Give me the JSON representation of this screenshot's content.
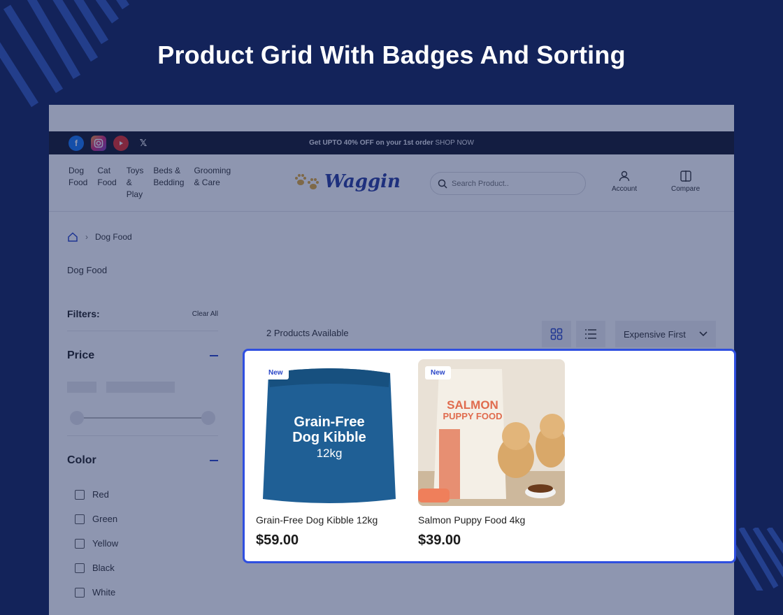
{
  "hero": {
    "title": "Product Grid With Badges And Sorting"
  },
  "promo": {
    "bold": "Get UPTO 40% OFF on your 1st order",
    "link": "SHOP NOW"
  },
  "social": [
    "facebook-icon",
    "instagram-icon",
    "youtube-icon",
    "x-icon"
  ],
  "nav": {
    "categories": [
      "Dog\nFood",
      "Cat\nFood",
      "Toys\n&\nPlay",
      "Beds &\nBedding",
      "Grooming\n& Care"
    ],
    "logo": "Waggin",
    "search_placeholder": "Search Product..",
    "account": "Account",
    "compare": "Compare"
  },
  "breadcrumb": {
    "current": "Dog Food"
  },
  "page_title": "Dog Food",
  "filters": {
    "title": "Filters:",
    "clear": "Clear All",
    "price_title": "Price",
    "color_title": "Color",
    "colors": [
      "Red",
      "Green",
      "Yellow",
      "Black",
      "White"
    ]
  },
  "toolbar": {
    "count": "2 Products Available",
    "sort": "Expensive First"
  },
  "products": [
    {
      "badge": "New",
      "name": "Grain-Free Dog Kibble 12kg",
      "price": "$59.00",
      "bag_line1": "Grain-Free",
      "bag_line2": "Dog Kibble",
      "bag_line3": "12kg"
    },
    {
      "badge": "New",
      "name": "Salmon Puppy Food 4kg",
      "price": "$39.00",
      "bag_line1": "SALMON",
      "bag_line2": "PUPPY FOOD"
    }
  ],
  "colors": {
    "background": "#13235a",
    "accent": "#2f4fe0"
  }
}
